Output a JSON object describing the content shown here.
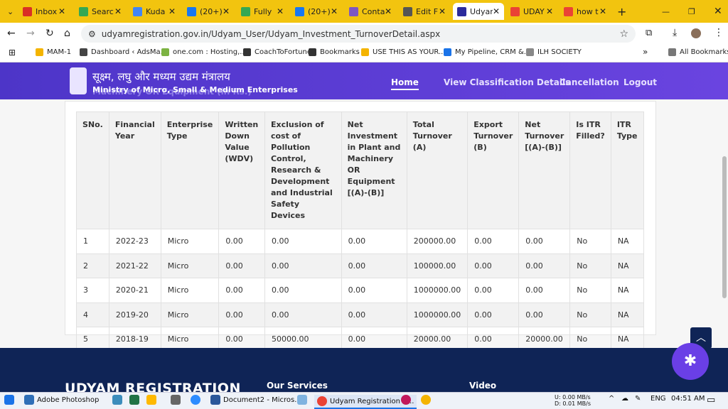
{
  "tabs": [
    {
      "label": "Inbox",
      "color": "#d93025"
    },
    {
      "label": "Searc",
      "color": "#34a853"
    },
    {
      "label": "Kuda",
      "color": "#4285f4"
    },
    {
      "label": "(20+)",
      "color": "#1877f2"
    },
    {
      "label": "Fully",
      "color": "#34a853"
    },
    {
      "label": "(20+)",
      "color": "#1877f2"
    },
    {
      "label": "Conta",
      "color": "#7e57c2"
    },
    {
      "label": "Edit F",
      "color": "#555555"
    },
    {
      "label": "Udyar",
      "color": "#2b2b9c"
    },
    {
      "label": "UDAY",
      "color": "#ea4335"
    },
    {
      "label": "how t",
      "color": "#ea4335"
    }
  ],
  "address": {
    "url": "udyamregistration.gov.in/Udyam_User/Udyam_Investment_TurnoverDetail.aspx"
  },
  "bookmarks": [
    {
      "label": "MAM-1"
    },
    {
      "label": "Dashboard ‹ AdsMa..."
    },
    {
      "label": "one.com : Hosting,..."
    },
    {
      "label": "CoachToFortune"
    },
    {
      "label": "Bookmarks"
    },
    {
      "label": "USE THIS AS YOUR..."
    },
    {
      "label": "My Pipeline, CRM &..."
    },
    {
      "label": "ILH SOCIETY"
    },
    {
      "label": "All Bookmarks"
    }
  ],
  "site": {
    "hindi_title": "सूक्ष्म, लघु और मध्यम उद्यम मंत्रालय",
    "english_title": "Ministry of Micro, Small & Medium Enterprises",
    "behind_heading": "Machinery OR Equipment (in Rs.)",
    "nav": [
      "Home",
      "View Classification Details",
      "Cancellation",
      "Logout"
    ]
  },
  "table": {
    "headers": [
      "SNo.",
      "Financial Year",
      "Enterprise Type",
      "Written Down Value (WDV)",
      "Exclusion of cost of Pollution Control, Research & Development and Industrial Safety Devices",
      "Net Investment in Plant and Machinery OR Equipment [(A)-(B)]",
      "Total Turnover (A)",
      "Export Turnover (B)",
      "Net Turnover [(A)-(B)]",
      "Is ITR Filled?",
      "ITR Type"
    ],
    "rows": [
      [
        "1",
        "2022-23",
        "Micro",
        "0.00",
        "0.00",
        "0.00",
        "200000.00",
        "0.00",
        "0.00",
        "No",
        "NA"
      ],
      [
        "2",
        "2021-22",
        "Micro",
        "0.00",
        "0.00",
        "0.00",
        "100000.00",
        "0.00",
        "0.00",
        "No",
        "NA"
      ],
      [
        "3",
        "2020-21",
        "Micro",
        "0.00",
        "0.00",
        "0.00",
        "1000000.00",
        "0.00",
        "0.00",
        "No",
        "NA"
      ],
      [
        "4",
        "2019-20",
        "Micro",
        "0.00",
        "0.00",
        "0.00",
        "1000000.00",
        "0.00",
        "0.00",
        "No",
        "NA"
      ],
      [
        "5",
        "2018-19",
        "Micro",
        "0.00",
        "50000.00",
        "0.00",
        "20000.00",
        "0.00",
        "20000.00",
        "No",
        "NA"
      ]
    ]
  },
  "footer": {
    "brand": "UDYAM REGISTRATION",
    "services": "Our Services",
    "video": "Video"
  },
  "taskbar": {
    "items": [
      "Adobe Photoshop",
      "Document2 - Micros...",
      "Udyam Registration - ..."
    ],
    "net_up": "U:",
    "net_up_val": "0.00 MB/s",
    "net_down": "D:",
    "net_down_val": "0.01 MB/s",
    "lang": "ENG",
    "time": "04:51 AM"
  }
}
